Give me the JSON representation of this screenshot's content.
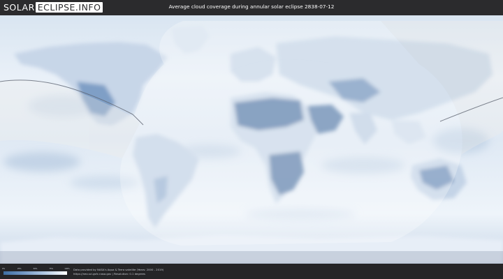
{
  "header": {
    "logo_part1": "SOLAR",
    "logo_part2": "ECLIPSE.INFO",
    "title": "Average cloud coverage during annular solar eclipse 2838-07-12"
  },
  "map": {
    "type": "world cloud coverage map",
    "eclipse_path": "annular",
    "colors": {
      "ocean_light": "#e8f0f8",
      "cloud_white": "#f7fafd",
      "clear_sky_blue": "#5a7fae",
      "path_line": "#666b73"
    }
  },
  "legend": {
    "ticks": [
      "0%",
      "25%",
      "50%",
      "75%",
      "100%"
    ],
    "gradient": [
      "#3f6fa3",
      "#6f95c2",
      "#a9c2de",
      "#ffffff"
    ]
  },
  "credit": {
    "line1": "Data provided by NASA's Aqua & Terra satellite (Years: 2000 - 2019)",
    "line2": "https://neo.sci.gsfc.nasa.gov  |  Resolution: 0.1 degrees"
  }
}
